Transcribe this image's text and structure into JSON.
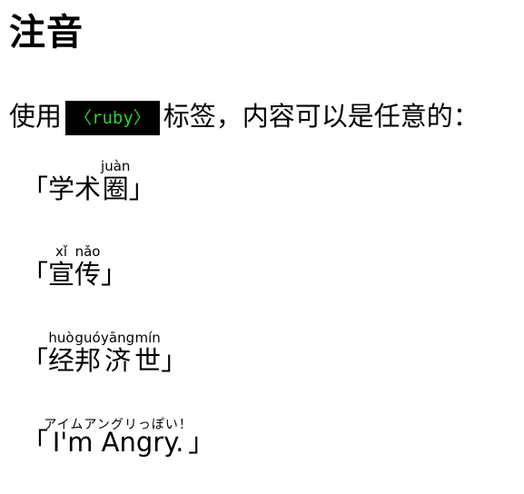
{
  "title": "注音",
  "intro": {
    "before": "使用",
    "code": "〈ruby〉",
    "after": "标签，内容可以是任意的："
  },
  "brackets": {
    "open": "「",
    "close": "」"
  },
  "examples": [
    {
      "ruby": [
        {
          "base": "学术",
          "rt": ""
        },
        {
          "base": "圈",
          "rt": "juàn"
        }
      ]
    },
    {
      "ruby": [
        {
          "base": "宣",
          "rt": "xǐ"
        },
        {
          "base": "传",
          "rt": "nǎo"
        }
      ]
    },
    {
      "ruby": [
        {
          "base": "经",
          "rt": "huò"
        },
        {
          "base": "邦",
          "rt": "guó"
        },
        {
          "base": "济",
          "rt": "yāng"
        },
        {
          "base": "世",
          "rt": "mín"
        }
      ]
    },
    {
      "ruby": [
        {
          "base": "I'm  Angry.",
          "rt": "アイムアングリっぽい！"
        }
      ]
    }
  ]
}
